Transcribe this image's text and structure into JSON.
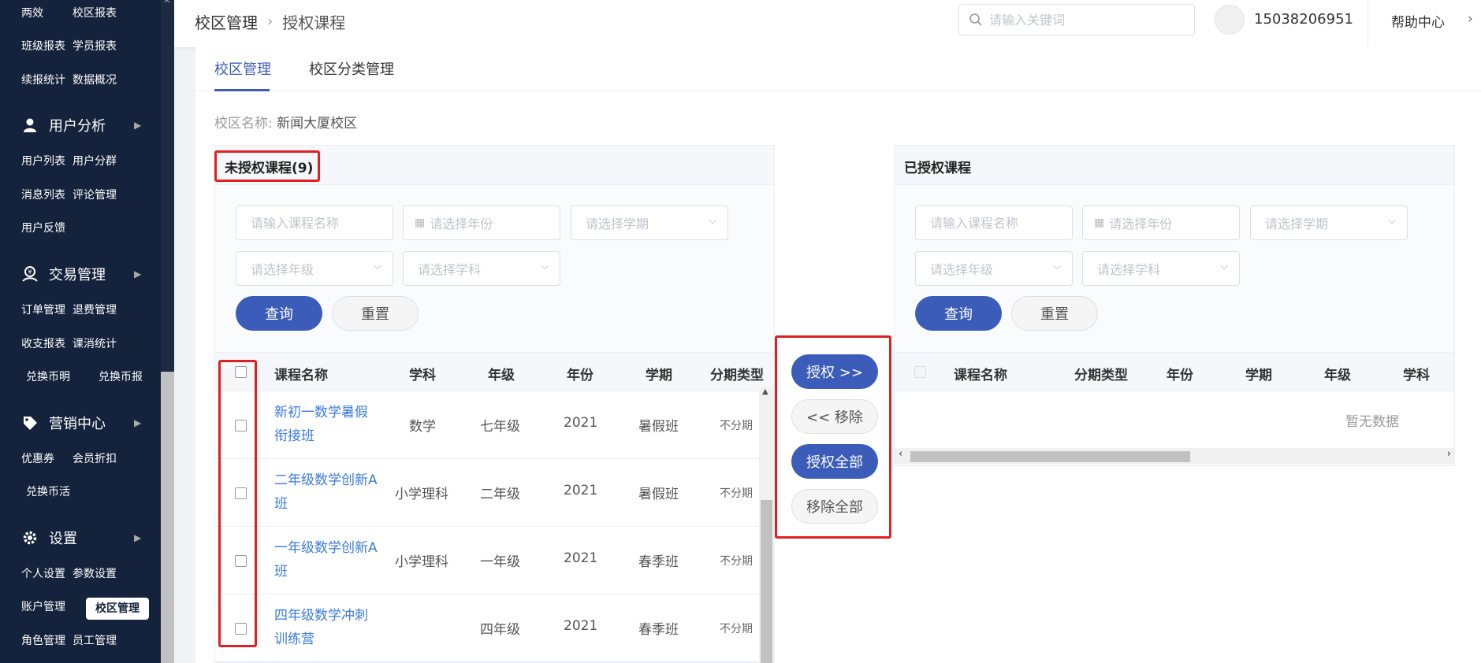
{
  "sidebar": {
    "rows": [
      [
        "两效",
        "校区报表"
      ],
      [
        "班级报表",
        "学员报表"
      ],
      [
        "续报统计",
        "数据概况"
      ]
    ],
    "groups": {
      "user": {
        "label": "用户分析",
        "items": [
          [
            "用户列表",
            "用户分群"
          ],
          [
            "消息列表",
            "评论管理"
          ],
          [
            "用户反馈",
            ""
          ]
        ]
      },
      "trade": {
        "label": "交易管理",
        "items": [
          [
            "订单管理",
            "退费管理"
          ],
          [
            "收支报表",
            "课消统计"
          ],
          [
            "兑换币明",
            "兑换币报"
          ]
        ]
      },
      "marketing": {
        "label": "营销中心",
        "items": [
          [
            "优惠券",
            "会员折扣"
          ],
          [
            "兑换币活",
            ""
          ]
        ]
      },
      "settings": {
        "label": "设置",
        "items": [
          [
            "个人设置",
            "参数设置"
          ],
          [
            "账户管理",
            "校区管理"
          ],
          [
            "角色管理",
            "员工管理"
          ]
        ]
      }
    }
  },
  "header": {
    "breadcrumb": [
      "校区管理",
      "授权课程"
    ],
    "search_placeholder": "请输入关键词",
    "user": "15038206951",
    "help": "帮助中心"
  },
  "tabs": [
    "校区管理",
    "校区分类管理"
  ],
  "campus": {
    "label": "校区名称:",
    "value": "新闻大厦校区"
  },
  "left_panel": {
    "title": "未授权课程(9)",
    "filters": {
      "course_name": "请输入课程名称",
      "year": "请选择年份",
      "term": "请选择学期",
      "grade": "请选择年级",
      "subject": "请选择学科"
    },
    "query": "查询",
    "reset": "重置",
    "columns": [
      "课程名称",
      "学科",
      "年级",
      "年份",
      "学期",
      "分期类型"
    ],
    "rows": [
      {
        "name": "新初一数学暑假衔接班",
        "subject": "数学",
        "grade": "七年级",
        "year": "2021",
        "term": "暑假班",
        "type": "不分期"
      },
      {
        "name": "二年级数学创新A班",
        "subject": "小学理科",
        "grade": "二年级",
        "year": "2021",
        "term": "暑假班",
        "type": "不分期"
      },
      {
        "name": "一年级数学创新A班",
        "subject": "小学理科",
        "grade": "一年级",
        "year": "2021",
        "term": "春季班",
        "type": "不分期"
      },
      {
        "name": "四年级数学冲刺训练营",
        "subject": "",
        "grade": "四年级",
        "year": "2021",
        "term": "春季班",
        "type": "不分期"
      }
    ]
  },
  "middle": {
    "authorize": "授权 >>",
    "remove": "<< 移除",
    "authorize_all": "授权全部",
    "remove_all": "移除全部"
  },
  "right_panel": {
    "title": "已授权课程",
    "filters": {
      "course_name": "请输入课程名称",
      "year": "请选择年份",
      "term": "请选择学期",
      "grade": "请选择年级",
      "subject": "请选择学科"
    },
    "query": "查询",
    "reset": "重置",
    "columns": [
      "课程名称",
      "分期类型",
      "年份",
      "学期",
      "年级",
      "学科"
    ],
    "empty": "暂无数据"
  },
  "colors": {
    "primary": "#3b5cb8",
    "sidebar": "#14223b",
    "highlight": "#e02020",
    "link": "#3b7be0"
  }
}
